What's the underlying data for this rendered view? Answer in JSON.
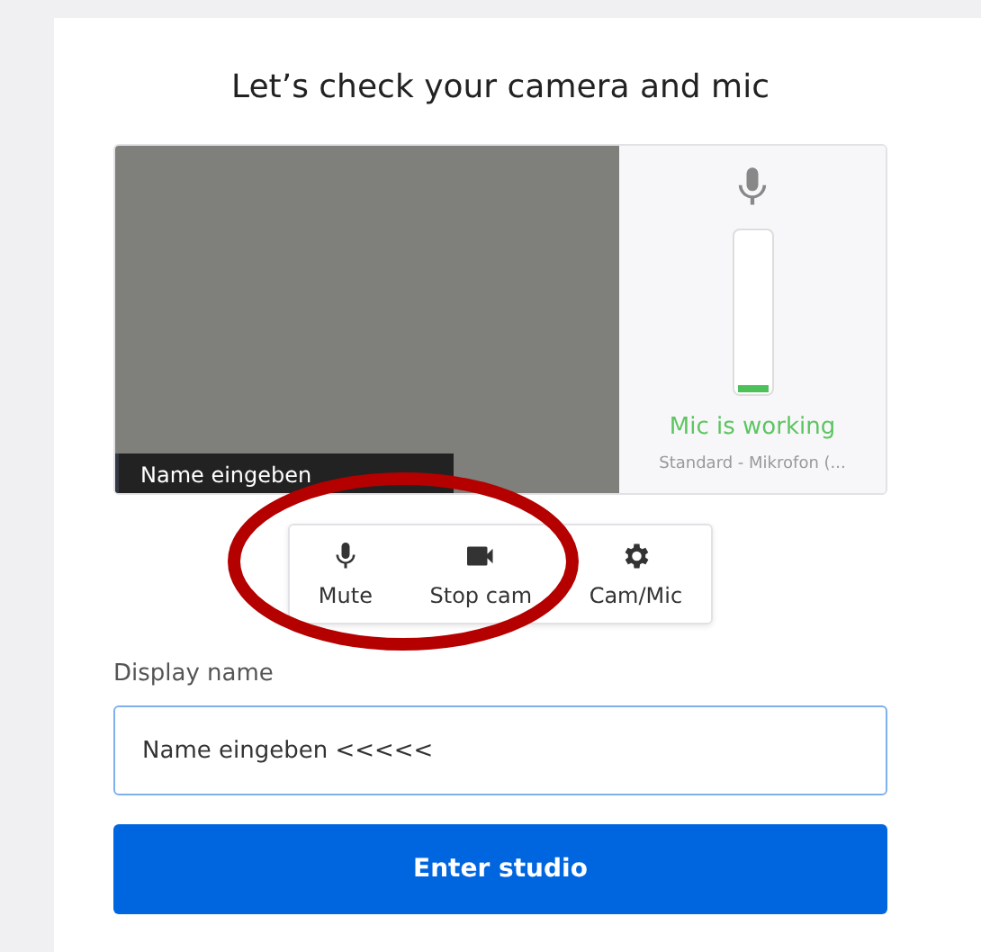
{
  "title": "Let’s check your camera and mic",
  "preview": {
    "name_tag": "Name eingeben",
    "mic_status": "Mic is working",
    "mic_device": "Standard - Mikrofon (...",
    "mic_level": {
      "level": 0.04
    }
  },
  "controls": [
    {
      "kind": "mic",
      "label": "Mute"
    },
    {
      "kind": "cam",
      "label": "Stop cam"
    },
    {
      "kind": "settings",
      "label": "Cam/Mic"
    }
  ],
  "display_name": {
    "label": "Display name",
    "value": "Name eingeben <<<<<"
  },
  "enter_button": "Enter studio"
}
